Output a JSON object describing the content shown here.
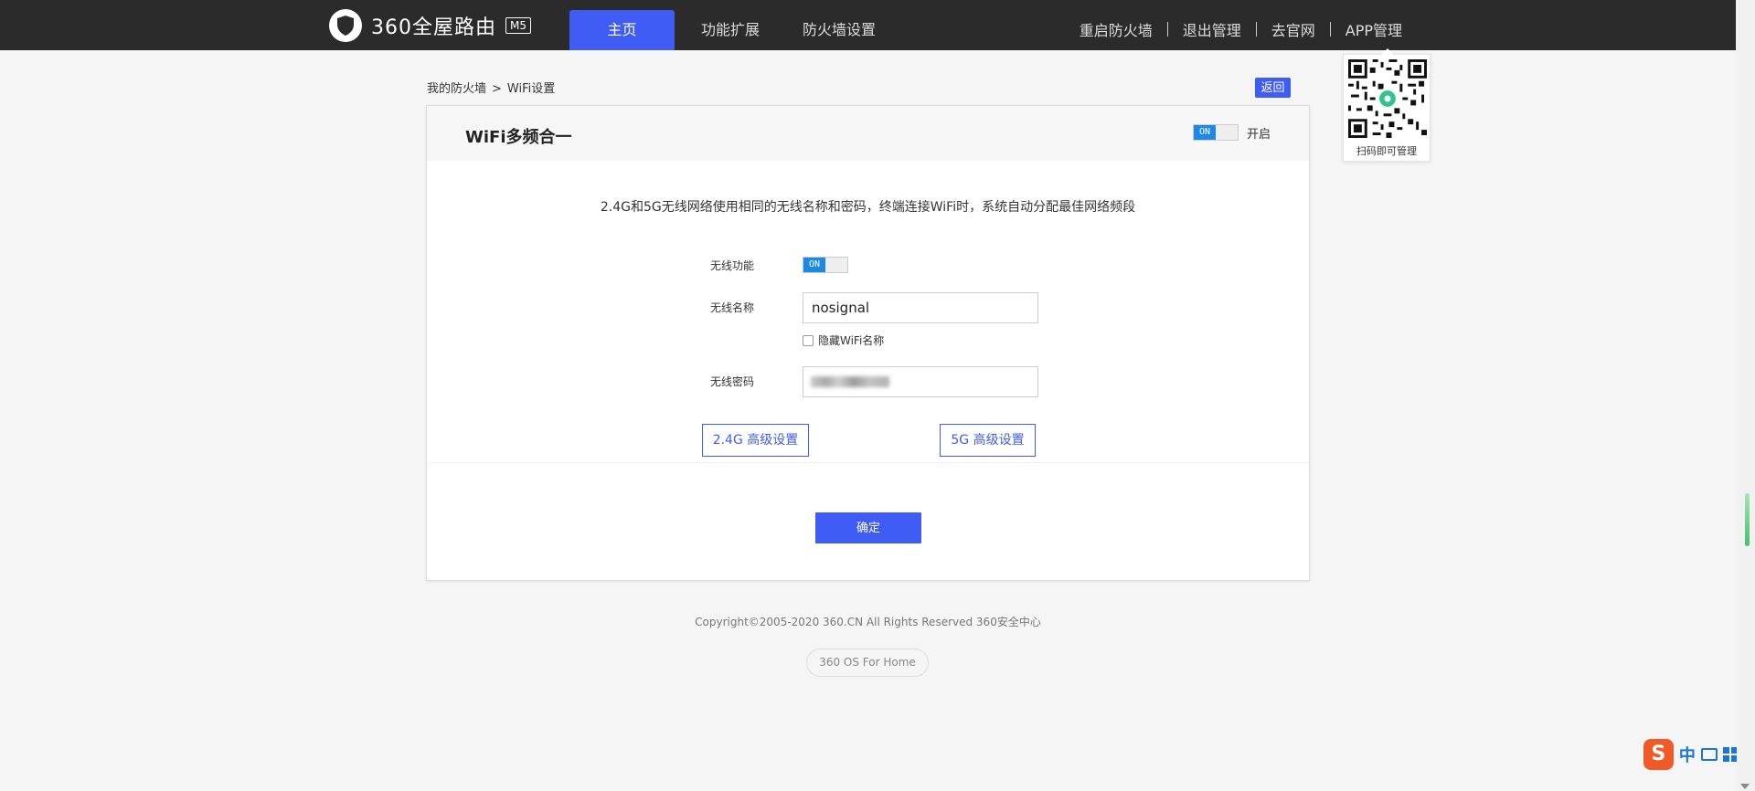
{
  "header": {
    "logo_text": "360全屋路由",
    "logo_badge": "M5",
    "nav": [
      {
        "label": "主页",
        "active": true
      },
      {
        "label": "功能扩展",
        "active": false
      },
      {
        "label": "防火墙设置",
        "active": false
      }
    ],
    "links": [
      "重启防火墙",
      "退出管理",
      "去官网",
      "APP管理"
    ]
  },
  "qr_popup": {
    "caption": "扫码即可管理"
  },
  "breadcrumb": {
    "root": "我的防火墙",
    "separator": ">",
    "current": "WiFi设置"
  },
  "back_label": "返回",
  "panel": {
    "title": "WiFi多频合一",
    "toggle_on_text": "ON",
    "toggle_label": "开启",
    "description": "2.4G和5G无线网络使用相同的无线名称和密码，终端连接WiFi时，系统自动分配最佳网络频段",
    "form": {
      "wireless_label": "无线功能",
      "wireless_toggle_text": "ON",
      "ssid_label": "无线名称",
      "ssid_value": "nosignal",
      "hide_ssid_label": "隐藏WiFi名称",
      "password_label": "无线密码"
    },
    "adv_24g_label": "2.4G 高级设置",
    "adv_5g_label": "5G 高级设置",
    "confirm_label": "确定"
  },
  "footer": {
    "copyright": "Copyright©2005-2020 360.CN All Rights Reserved 360安全中心",
    "os_label": "360 OS For Home"
  },
  "ime": {
    "logo": "S",
    "mode": "中"
  },
  "colors": {
    "accent": "#3f5cf5",
    "topbar": "#2b2b2b",
    "toggle_on": "#1e88e5"
  }
}
